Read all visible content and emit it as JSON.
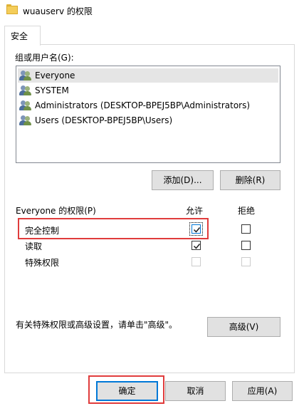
{
  "window": {
    "title": "wuauserv 的权限"
  },
  "tabs": [
    {
      "label": "安全"
    }
  ],
  "users": {
    "label": "组或用户名(G):",
    "items": [
      {
        "name": "Everyone",
        "selected": true
      },
      {
        "name": "SYSTEM",
        "selected": false
      },
      {
        "name": "Administrators (DESKTOP-BPEJ5BP\\Administrators)",
        "selected": false
      },
      {
        "name": "Users (DESKTOP-BPEJ5BP\\Users)",
        "selected": false
      }
    ],
    "add_label": "添加(D)...",
    "remove_label": "删除(R)"
  },
  "permissions": {
    "label": "Everyone 的权限(P)",
    "allow_header": "允许",
    "deny_header": "拒绝",
    "rows": [
      {
        "name": "完全控制",
        "allow": true,
        "deny": false,
        "disabled": false
      },
      {
        "name": "读取",
        "allow": true,
        "deny": false,
        "disabled": false
      },
      {
        "name": "特殊权限",
        "allow": false,
        "deny": false,
        "disabled": true
      }
    ]
  },
  "advanced": {
    "text": "有关特殊权限或高级设置，请单击\"高级\"。",
    "button_label": "高级(V)"
  },
  "footer": {
    "ok_label": "确定",
    "cancel_label": "取消",
    "apply_label": "应用(A)"
  },
  "colors": {
    "highlight_box": "#e03c3c",
    "focus_blue": "#0078d7"
  }
}
